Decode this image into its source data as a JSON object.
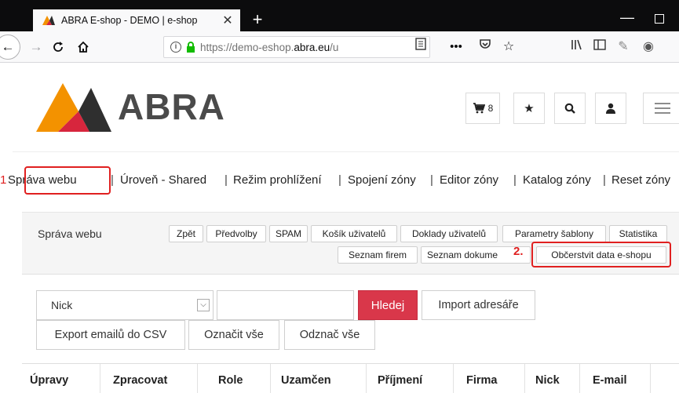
{
  "browser": {
    "tab_title": "ABRA E-shop - DEMO | e-shop",
    "new_tab": "+",
    "url_scheme": "https://",
    "url_prefix": "demo-eshop.",
    "url_host": "abra.eu",
    "url_path": "/u"
  },
  "header": {
    "logo_text": "ABRA",
    "cart_count": "8"
  },
  "admin_nav": {
    "marker1": "1",
    "items": [
      "Správa webu",
      "Úroveň - Shared",
      "Režim prohlížení",
      "Spojení zóny",
      "Editor zóny",
      "Katalog zóny",
      "Reset zóny"
    ]
  },
  "panel": {
    "title": "Správa webu",
    "buttons_row1": [
      "Zpět",
      "Předvolby",
      "SPAM",
      "Košík uživatelů",
      "Doklady uživatelů",
      "Parametry šablony",
      "Statistika"
    ],
    "buttons_row2": [
      "Seznam firem",
      "Seznam dokume",
      "Občerstvit data e-shopu"
    ],
    "marker2": "2."
  },
  "search": {
    "select_value": "Nick",
    "search_label": "Hledej",
    "import_label": "Import adresáře",
    "export_label": "Export emailů do CSV",
    "select_all_label": "Označit vše",
    "deselect_all_label": "Odznač vše"
  },
  "table": {
    "headers": [
      "Úpravy",
      "Zpracovat",
      "Role",
      "Uzamčen",
      "Příjmení",
      "Firma",
      "Nick",
      "E-mail"
    ]
  },
  "colors": {
    "accent_red": "#e02020",
    "search_button": "#d9374a",
    "logo_orange": "#f39200",
    "logo_red": "#d7263d"
  }
}
